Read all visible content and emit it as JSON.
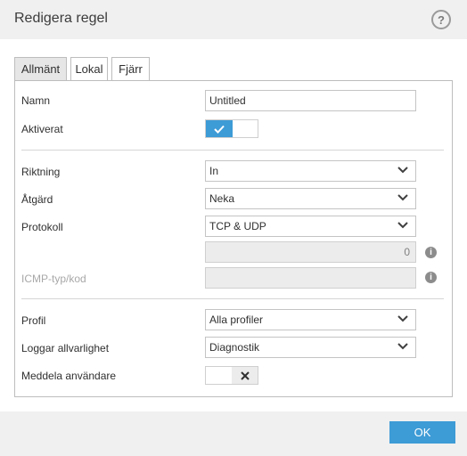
{
  "window": {
    "title": "Redigera regel",
    "help_icon": "?"
  },
  "tabs": [
    {
      "label": "Allmänt",
      "active": true
    },
    {
      "label": "Lokal",
      "active": false
    },
    {
      "label": "Fjärr",
      "active": false
    }
  ],
  "form": {
    "name": {
      "label": "Namn",
      "value": "Untitled"
    },
    "enabled": {
      "label": "Aktiverat",
      "state": true
    },
    "direction": {
      "label": "Riktning",
      "value": "In"
    },
    "action": {
      "label": "Åtgärd",
      "value": "Neka"
    },
    "protocol": {
      "label": "Protokoll",
      "value": "TCP & UDP"
    },
    "protocol_number": {
      "value": "0",
      "info_icon": "i"
    },
    "icmp": {
      "label": "ICMP-typ/kod",
      "value": "",
      "info_icon": "i"
    },
    "profile": {
      "label": "Profil",
      "value": "Alla profiler"
    },
    "log_severity": {
      "label": "Loggar allvarlighet",
      "value": "Diagnostik"
    },
    "notify_user": {
      "label": "Meddela användare",
      "state": false
    }
  },
  "footer": {
    "ok_label": "OK"
  },
  "colors": {
    "accent": "#3d9bd6",
    "title_bg": "#f0f0f0",
    "active_tab": "#e6e6e6"
  }
}
